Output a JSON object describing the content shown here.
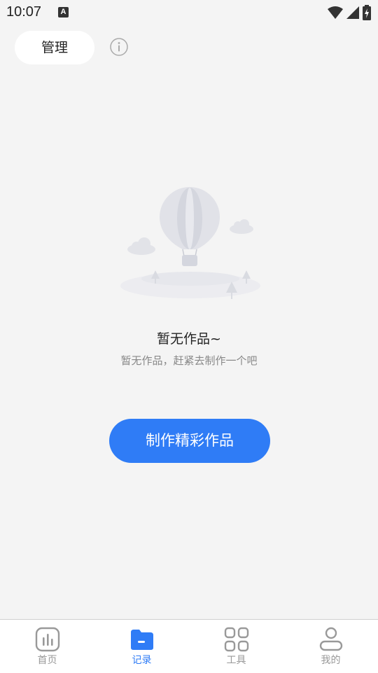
{
  "status_bar": {
    "time": "10:07",
    "notification_icon": "a-icon",
    "icons": [
      "wifi-icon",
      "signal-icon",
      "battery-icon"
    ]
  },
  "header": {
    "manage_label": "管理",
    "info_icon": "info-icon"
  },
  "empty_state": {
    "illustration": "balloon-illustration",
    "title": "暂无作品~",
    "subtitle": "暂无作品，赶紧去制作一个吧",
    "action_label": "制作精彩作品"
  },
  "tabbar": {
    "items": [
      {
        "label": "首页",
        "icon": "chart-icon",
        "active": false
      },
      {
        "label": "记录",
        "icon": "folder-icon",
        "active": true
      },
      {
        "label": "工具",
        "icon": "grid-icon",
        "active": false
      },
      {
        "label": "我的",
        "icon": "user-icon",
        "active": false
      }
    ]
  },
  "colors": {
    "accent": "#2f7cf6",
    "background": "#f4f4f4",
    "inactive": "#999999"
  }
}
